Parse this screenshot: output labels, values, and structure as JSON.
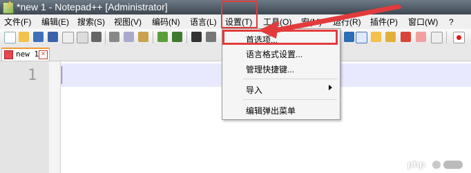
{
  "window": {
    "title": "*new 1 - Notepad++ [Administrator]"
  },
  "menubar": {
    "items": [
      {
        "label": "文件(F)"
      },
      {
        "label": "编辑(E)"
      },
      {
        "label": "搜索(S)"
      },
      {
        "label": "视图(V)"
      },
      {
        "label": "编码(N)"
      },
      {
        "label": "语言(L)"
      },
      {
        "label": "设置(T)"
      },
      {
        "label": "工具(O)"
      },
      {
        "label": "宏(M)"
      },
      {
        "label": "运行(R)"
      },
      {
        "label": "插件(P)"
      },
      {
        "label": "窗口(W)"
      },
      {
        "label": "?"
      }
    ]
  },
  "tabs": [
    {
      "label": "new 1"
    }
  ],
  "editor": {
    "line_number": "1"
  },
  "settings_menu": {
    "items": [
      {
        "label": "首选项..."
      },
      {
        "label": "语言格式设置..."
      },
      {
        "label": "管理快捷键..."
      },
      {
        "label": "导入"
      },
      {
        "label": "编辑弹出菜单"
      }
    ]
  },
  "watermark": {
    "text": "php"
  },
  "colors": {
    "highlight": "#e23b3b",
    "tab_accent": "#f29a2e",
    "current_line": "#e8e8ff"
  }
}
